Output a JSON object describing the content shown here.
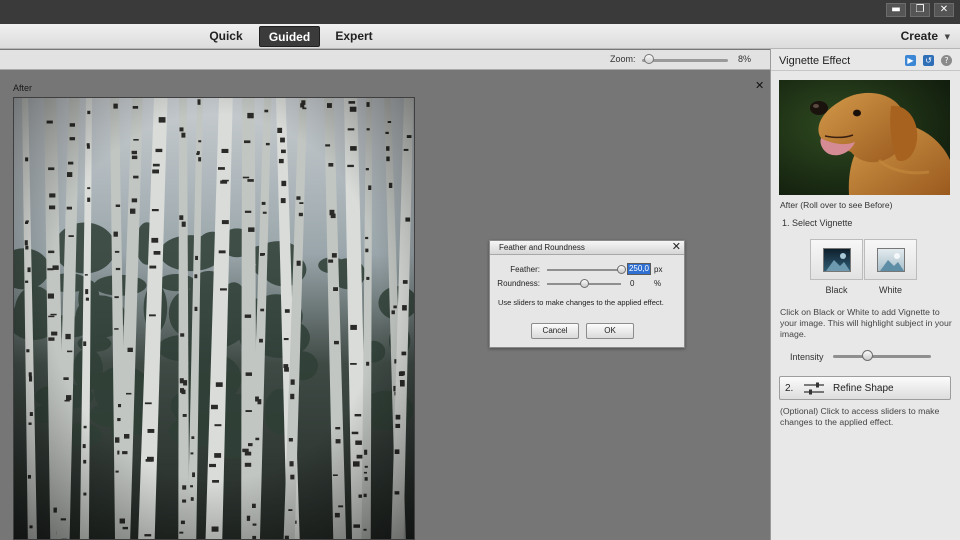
{
  "window": {
    "minimize_glyph": "▬",
    "restore_glyph": "❐",
    "close_glyph": "✕"
  },
  "mode_tabs": [
    "Quick",
    "Guided",
    "Expert"
  ],
  "active_tab": "Guided",
  "create_label": "Create",
  "zoom": {
    "label": "Zoom:",
    "value": "8%",
    "level": 0.08
  },
  "canvas": {
    "label": "After",
    "close_glyph": "✕"
  },
  "dialog": {
    "title": "Feather and Roundness",
    "close_glyph": "✕",
    "feather_label": "Feather:",
    "feather_value": "250,0",
    "feather_unit": "px",
    "feather_level": 1.0,
    "roundness_label": "Roundness:",
    "roundness_value": "0",
    "roundness_unit": "%",
    "roundness_level": 0.5,
    "help": "Use sliders to make changes to the applied effect.",
    "cancel": "Cancel",
    "ok": "OK"
  },
  "panel": {
    "title": "Vignette Effect",
    "icons": [
      "play-icon",
      "undo-icon",
      "help-icon"
    ],
    "after_note": "After (Roll over to see Before)",
    "step1": "1. Select Vignette",
    "black_label": "Black",
    "white_label": "White",
    "desc": "Click on Black or White to add Vignette to your image. This will highlight subject in your image.",
    "intensity_label": "Intensity",
    "intensity_level": 0.35,
    "refine_number": "2.",
    "refine_label": "Refine Shape",
    "desc2": "(Optional) Click to access sliders to make changes to the applied effect."
  }
}
